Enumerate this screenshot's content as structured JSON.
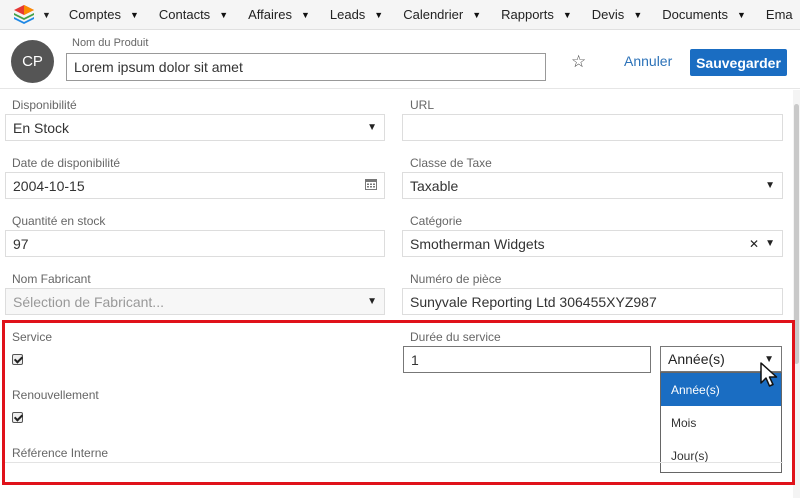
{
  "nav": {
    "items": [
      {
        "label": "Comptes"
      },
      {
        "label": "Contacts"
      },
      {
        "label": "Affaires"
      },
      {
        "label": "Leads"
      },
      {
        "label": "Calendrier"
      },
      {
        "label": "Rapports"
      },
      {
        "label": "Devis"
      },
      {
        "label": "Documents"
      },
      {
        "label": "Ema"
      }
    ]
  },
  "header": {
    "avatar_initials": "CP",
    "name_label": "Nom du Produit",
    "name_value": "Lorem ipsum dolor sit amet",
    "cancel_label": "Annuler",
    "save_label": "Sauvegarder"
  },
  "form": {
    "availability": {
      "label": "Disponibilité",
      "value": "En Stock"
    },
    "url": {
      "label": "URL",
      "value": ""
    },
    "availability_date": {
      "label": "Date de disponibilité",
      "value": "2004-10-15"
    },
    "tax_class": {
      "label": "Classe de Taxe",
      "value": "Taxable"
    },
    "stock_qty": {
      "label": "Quantité en stock",
      "value": "97"
    },
    "category": {
      "label": "Catégorie",
      "value": "Smotherman Widgets"
    },
    "manufacturer": {
      "label": "Nom Fabricant",
      "placeholder": "Sélection de Fabricant..."
    },
    "part_number": {
      "label": "Numéro de pièce",
      "value": "Sunyvale Reporting Ltd 306455XYZ987"
    },
    "service": {
      "label": "Service",
      "checked": true
    },
    "service_duration": {
      "label": "Durée du service",
      "value": "1",
      "unit": "Année(s)",
      "options": [
        "Année(s)",
        "Mois",
        "Jour(s)"
      ],
      "highlighted_option": "Année(s)"
    },
    "renewal": {
      "label": "Renouvellement",
      "checked": true
    },
    "internal_ref": {
      "label": "Référence Interne"
    }
  },
  "colors": {
    "accent": "#1a6dc2",
    "highlight_border": "#e0121a"
  }
}
